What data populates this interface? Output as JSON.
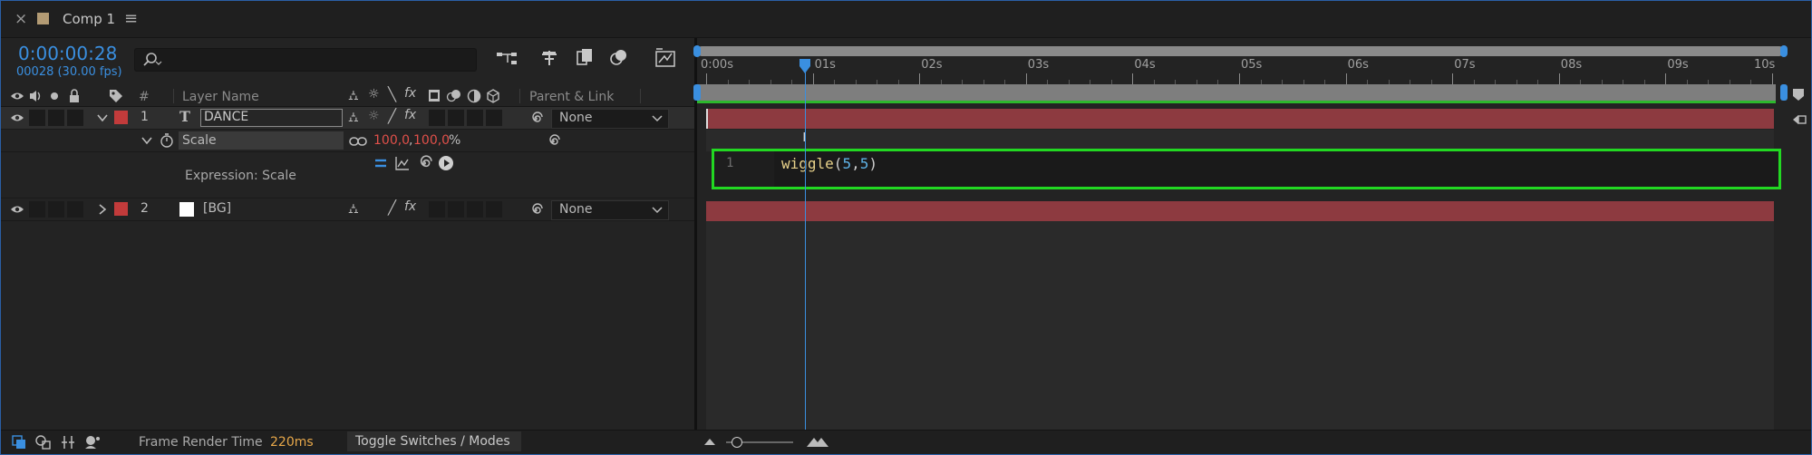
{
  "tab": {
    "close_glyph": "×",
    "title": "Comp 1",
    "menu_glyph": "≡",
    "swatch_color": "#b39b74"
  },
  "header": {
    "timecode": "0:00:00:28",
    "frame_info": "00028 (30.00 fps)",
    "search_placeholder": ""
  },
  "columns": {
    "number": "#",
    "layer_name": "Layer Name",
    "parent_link": "Parent & Link"
  },
  "layers": [
    {
      "index": "1",
      "type_glyph": "T",
      "name": "DANCE",
      "label_color": "#c23b3b",
      "parent": "None",
      "property": {
        "name": "Scale",
        "value_x": "100,0",
        "value_y": "100,0",
        "unit": "%"
      },
      "expression_label": "Expression: Scale"
    },
    {
      "index": "2",
      "name": "[BG]",
      "label_color": "#c23b3b",
      "parent": "None"
    }
  ],
  "timeline": {
    "ticks": [
      "0:00s",
      "01s",
      "02s",
      "03s",
      "04s",
      "05s",
      "06s",
      "07s",
      "08s",
      "09s",
      "10s"
    ],
    "playhead_seconds": 0.93,
    "duration_seconds": 10,
    "bar_color": "#8d3a40",
    "work_area_color": "#2db82d"
  },
  "expression_editor": {
    "line_number": "1",
    "code_fn": "wiggle",
    "code_open": "(",
    "code_arg1": "5",
    "code_comma": ",",
    "code_arg2": "5",
    "code_close": ")",
    "highlight_color": "#22d822"
  },
  "footer": {
    "frame_render_label": "Frame Render Time",
    "frame_render_value": "220ms",
    "toggle_label": "Toggle Switches / Modes"
  },
  "colors": {
    "accent_blue": "#3a8fe0",
    "keyframe_red": "#e0504a",
    "render_orange": "#e8a84a"
  }
}
